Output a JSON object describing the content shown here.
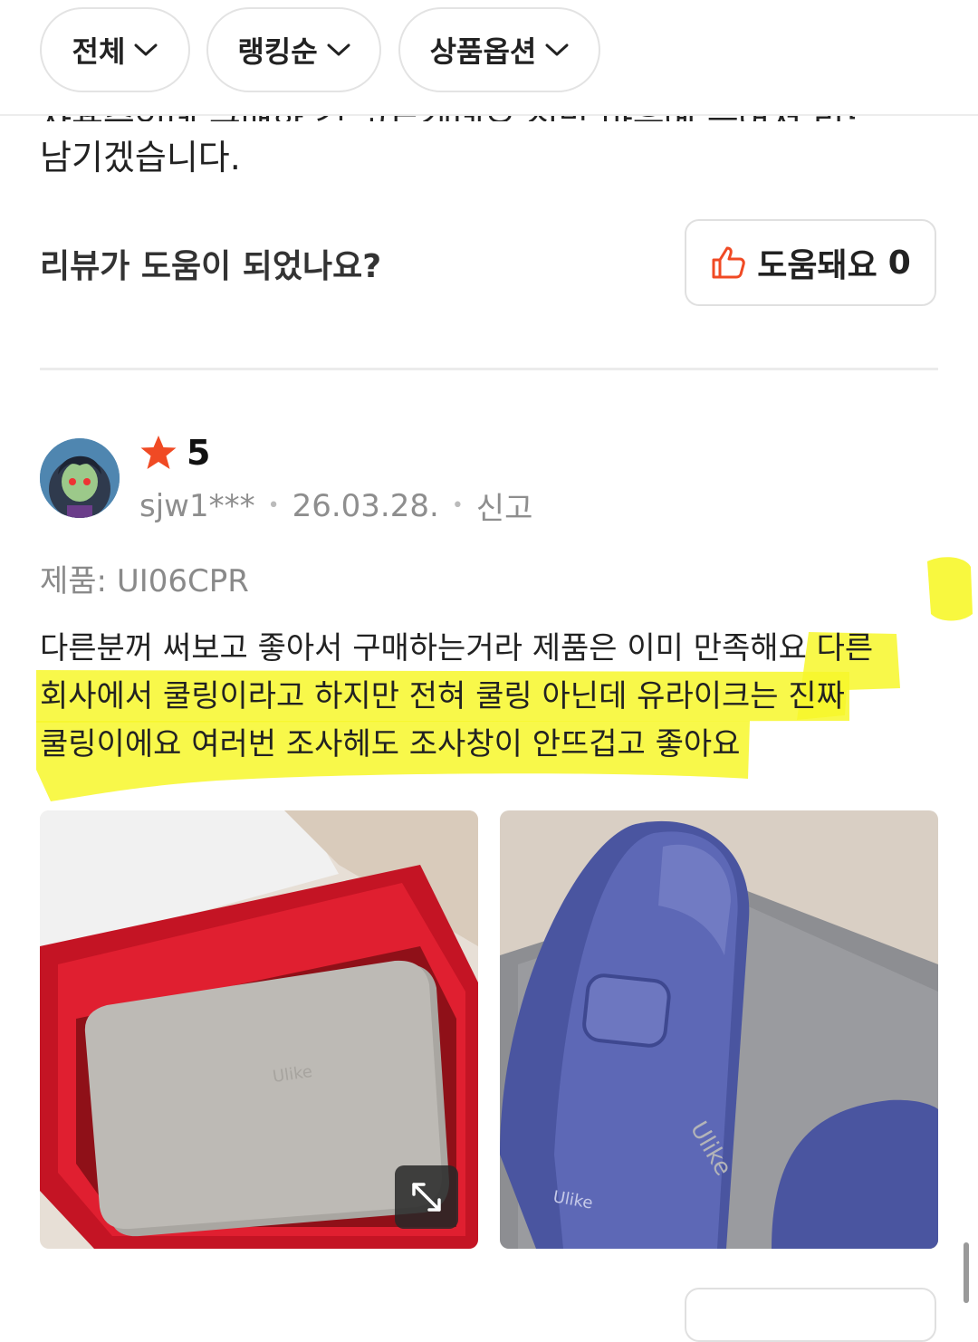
{
  "filters": [
    {
      "label": "전체",
      "icon": "chevron-down-icon"
    },
    {
      "label": "랭킹순",
      "icon": "chevron-down-icon"
    },
    {
      "label": "상품옵션",
      "icon": "chevron-down-icon"
    }
  ],
  "previous_review": {
    "cut_line": "사용중인데 구매한 걸 고르겠네요 정말 마음에 들어서 리뷰 한 번 더",
    "last_line": "남기겠습니다."
  },
  "helpful": {
    "question": "리뷰가 도움이 되었나요?",
    "button_label": "도움돼요",
    "count": "0"
  },
  "review": {
    "rating": "5",
    "username": "sjw1***",
    "date": "26.03.28.",
    "report_label": "신고",
    "product_label": "제품: UI06CPR",
    "body_lines": [
      "다른분꺼 써보고 좋아서 구매하는거라 제품은 이미 만족해요 다른",
      "회사에서 쿨링이라고 하지만 전혀 쿨링 아닌데 유라이크는 진짜",
      "쿨링이에요 여러번 조사헤도 조사창이 안뜨겁고 좋아요"
    ],
    "photo_brand_text": "Ulike"
  },
  "colors": {
    "star": "#f04a24",
    "thumb": "#f04a24",
    "highlighter": "#f7f72a",
    "device_blue": "#5560a8",
    "box_red": "#d71a2b"
  }
}
